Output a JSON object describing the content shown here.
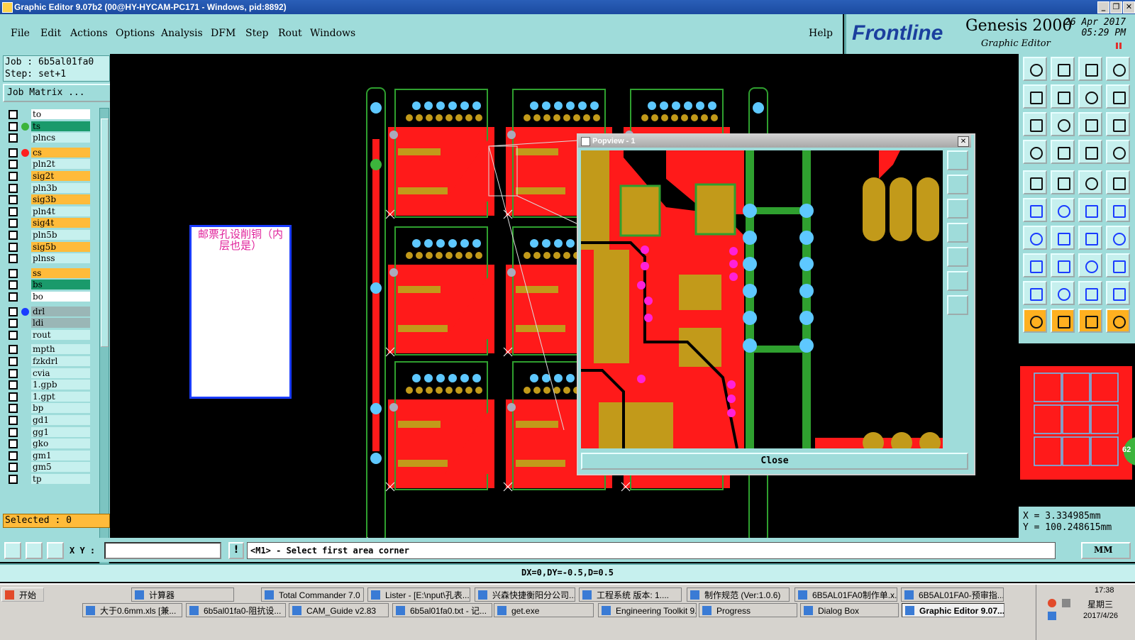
{
  "window": {
    "title": "Graphic Editor 9.07b2 (00@HY-HYCAM-PC171 - Windows, pid:8892)",
    "controls": [
      "_",
      "❐",
      "✕"
    ]
  },
  "menu": {
    "items": [
      "File",
      "Edit",
      "Actions",
      "Options",
      "Analysis",
      "DFM",
      "Step",
      "Rout",
      "Windows"
    ],
    "help": "Help"
  },
  "brand": {
    "logo": "Frontline",
    "product": "Genesis 2000",
    "subtitle": "Graphic Editor",
    "date": "26 Apr 2017",
    "time": "05:29 PM"
  },
  "job": {
    "job_line": "Job : 6b5al01fa0",
    "step_line": "Step: set+1",
    "matrix_button": "Job Matrix ...",
    "selected": "Selected : 0"
  },
  "layers": [
    {
      "name": "to",
      "bg": "#ffffff",
      "dot": ""
    },
    {
      "name": "ts",
      "bg": "#1a9a6b",
      "dot": "#3cb43c"
    },
    {
      "name": "plncs",
      "bg": "#c6f0ee",
      "dot": ""
    },
    {
      "name": "cs",
      "bg": "#ffbb3a",
      "dot": "#ff2020"
    },
    {
      "name": "pln2t",
      "bg": "#c6f0ee",
      "dot": ""
    },
    {
      "name": "sig2t",
      "bg": "#ffbb3a",
      "dot": ""
    },
    {
      "name": "pln3b",
      "bg": "#c6f0ee",
      "dot": ""
    },
    {
      "name": "sig3b",
      "bg": "#ffbb3a",
      "dot": ""
    },
    {
      "name": "pln4t",
      "bg": "#c6f0ee",
      "dot": ""
    },
    {
      "name": "sig4t",
      "bg": "#ffbb3a",
      "dot": ""
    },
    {
      "name": "pln5b",
      "bg": "#c6f0ee",
      "dot": ""
    },
    {
      "name": "sig5b",
      "bg": "#ffbb3a",
      "dot": ""
    },
    {
      "name": "plnss",
      "bg": "#c6f0ee",
      "dot": ""
    },
    {
      "name": "ss",
      "bg": "#ffbb3a",
      "dot": ""
    },
    {
      "name": "bs",
      "bg": "#1a9a6b",
      "dot": ""
    },
    {
      "name": "bo",
      "bg": "#ffffff",
      "dot": ""
    },
    {
      "name": "drl",
      "bg": "#9ab6b6",
      "dot": "#1a3cff"
    },
    {
      "name": "ldi",
      "bg": "#9ab6b6",
      "dot": ""
    },
    {
      "name": "rout",
      "bg": "#c6f0ee",
      "dot": ""
    },
    {
      "name": "mpth",
      "bg": "#c6f0ee",
      "dot": ""
    },
    {
      "name": "fzkdrl",
      "bg": "#c6f0ee",
      "dot": ""
    },
    {
      "name": "cvia",
      "bg": "#c6f0ee",
      "dot": ""
    },
    {
      "name": "1.gpb",
      "bg": "#c6f0ee",
      "dot": ""
    },
    {
      "name": "1.gpt",
      "bg": "#c6f0ee",
      "dot": ""
    },
    {
      "name": "bp",
      "bg": "#c6f0ee",
      "dot": ""
    },
    {
      "name": "gd1",
      "bg": "#c6f0ee",
      "dot": ""
    },
    {
      "name": "gg1",
      "bg": "#c6f0ee",
      "dot": ""
    },
    {
      "name": "gko",
      "bg": "#c6f0ee",
      "dot": ""
    },
    {
      "name": "gm1",
      "bg": "#c6f0ee",
      "dot": ""
    },
    {
      "name": "gm5",
      "bg": "#c6f0ee",
      "dot": ""
    },
    {
      "name": "tp",
      "bg": "#c6f0ee",
      "dot": ""
    }
  ],
  "canvas": {
    "note": "邮票孔设削铜（内层也是）"
  },
  "popview": {
    "title": "Popview - 1",
    "close_x": "✕",
    "close_button": "Close"
  },
  "coords": {
    "x": "X  =   3.334985mm",
    "y": "Y  = 100.248615mm",
    "badge": "62"
  },
  "cmdbar": {
    "xy_label": "X Y :",
    "xy_value": "",
    "bang": "!",
    "prompt": "<M1> - Select first area corner",
    "units": "MM"
  },
  "status": {
    "delta": "DX=0,DY=-0.5,D=0.5"
  },
  "taskbar": {
    "start": "开始",
    "row1": [
      "计算器",
      "Total Commander 7.0 ...",
      "Lister - [E:\\nput\\孔表...",
      "兴森快捷衡阳分公司...",
      "工程系统  版本: 1....",
      "制作规范 (Ver:1.0.6)",
      "6B5AL01FA0制作单.x...",
      "6B5AL01FA0-预审指..."
    ],
    "row2": [
      "大于0.6mm.xls [兼...",
      "6b5al01fa0-阻抗设...",
      "CAM_Guide v2.83",
      "6b5al01fa0.txt - 记...",
      "get.exe",
      "Engineering Toolkit 9....",
      "Progress",
      "Dialog Box",
      "Graphic Editor 9.07..."
    ],
    "clock": "17:38",
    "weekday": "星期三",
    "date": "2017/4/26"
  },
  "colors": {
    "panel": "#9fdcda",
    "copper": "#ff1a1a",
    "pad": "#c29a1a",
    "silk": "#2fa02f",
    "drill": "#5ec8ff"
  }
}
